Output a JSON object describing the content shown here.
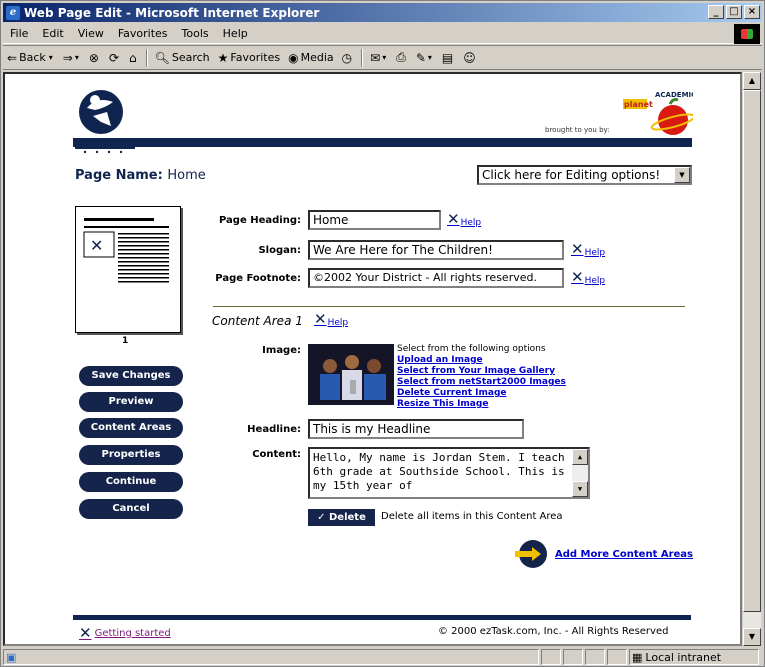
{
  "window": {
    "title": "Web Page Edit - Microsoft Internet Explorer"
  },
  "menu": [
    "File",
    "Edit",
    "View",
    "Favorites",
    "Tools",
    "Help"
  ],
  "toolbar": {
    "back": "Back",
    "search": "Search",
    "favorites": "Favorites",
    "media": "Media"
  },
  "status": {
    "zone": "Local intranet"
  },
  "page": {
    "page_name_label": "Page Name:",
    "page_name_value": "Home",
    "editing_options": "Click here for Editing options!",
    "brought_to_you_by": "brought to you by:",
    "thumbnail_number": "1",
    "nav_buttons": [
      "Save Changes",
      "Preview",
      "Content Areas",
      "Properties",
      "Continue",
      "Cancel"
    ],
    "fields": {
      "heading_label": "Page Heading:",
      "heading_value": "Home",
      "slogan_label": "Slogan:",
      "slogan_value": "We Are Here for The Children!",
      "footnote_label": "Page Footnote:",
      "footnote_value": "©2002 Your District - All rights reserved."
    },
    "help_label": "Help",
    "content_area": {
      "title": "Content Area 1",
      "image_label": "Image:",
      "options_intro": "Select from the following options",
      "options": [
        "Upload an Image",
        "Select from Your Image Gallery",
        "Select from netStart2000 Images",
        "Delete Current Image",
        "Resize This Image"
      ],
      "headline_label": "Headline:",
      "headline_value": "This is my Headline",
      "content_label": "Content:",
      "content_value": "Hello, My name is Jordan Stem. I teach 6th grade at Southside School. This is my 15th year of",
      "delete_button": "✓ Delete",
      "delete_text": "Delete all items in this Content Area"
    },
    "add_more": "Add More Content Areas",
    "getting_started": "Getting started",
    "copyright": "© 2000 ezTask.com, Inc. - All Rights Reserved"
  }
}
